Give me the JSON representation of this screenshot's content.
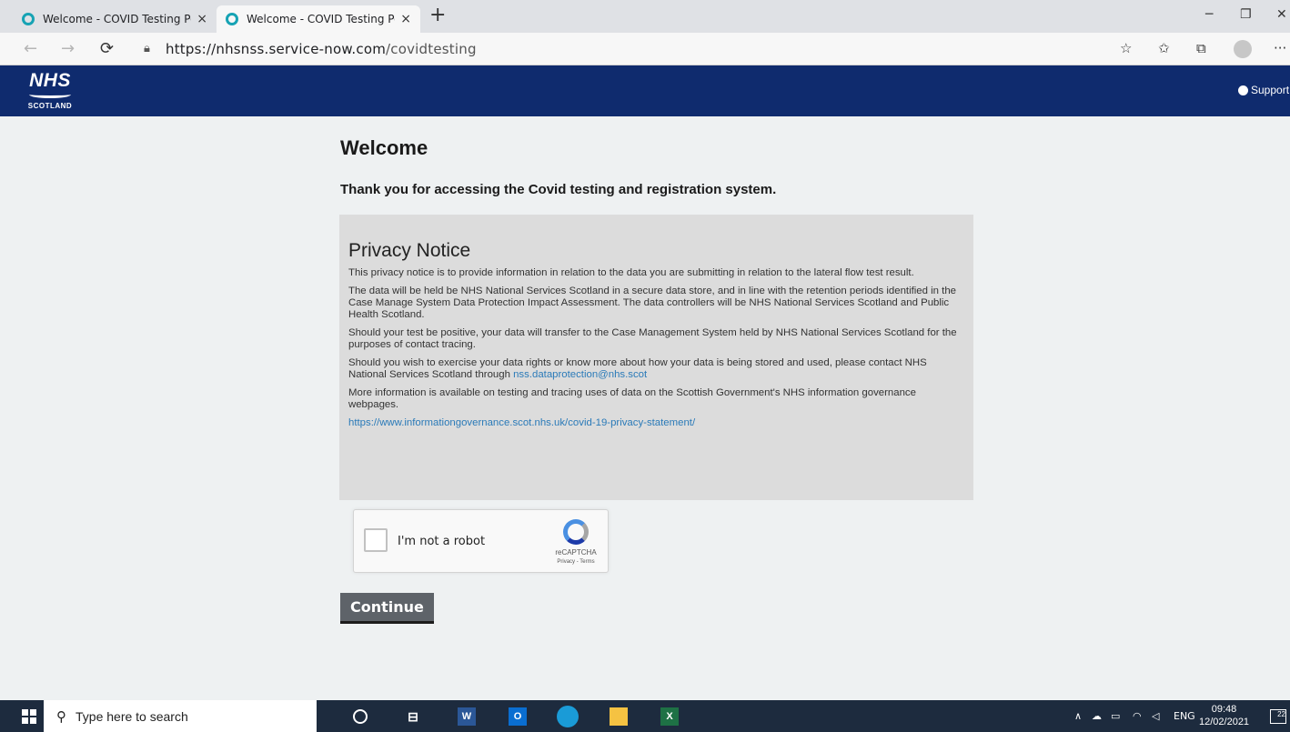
{
  "browser": {
    "tabs": [
      {
        "title": "Welcome - COVID Testing Portal",
        "close": "×"
      },
      {
        "title": "Welcome - COVID Testing Portal",
        "close": "×"
      }
    ],
    "new_tab": "+",
    "window_controls": {
      "minimize": "─",
      "maximize": "❐",
      "close": "✕"
    },
    "nav": {
      "back": "←",
      "forward": "→",
      "refresh": "⟳"
    },
    "url_host": "https://nhsnss.service-now.com",
    "url_path": "/covidtesting",
    "toolbar_icons": [
      "star-add-icon",
      "favorites-icon",
      "collections-icon",
      "profile-icon",
      "more-icon"
    ],
    "more": "···"
  },
  "header": {
    "logo_text": "NHS",
    "logo_sub": "SCOTLAND",
    "support_label": "Support"
  },
  "main": {
    "title": "Welcome",
    "subtitle": "Thank you for accessing the Covid testing and registration system.",
    "privacy": {
      "heading": "Privacy Notice",
      "p1": "This privacy notice is to provide information in relation to the data you are submitting in relation to the lateral flow test result.",
      "p2": "The data will be held be NHS National Services Scotland in a secure data store, and in line with the retention periods identified in the Case Manage System Data Protection Impact Assessment. The data controllers will be NHS National Services Scotland and Public Health Scotland.",
      "p3": "Should your test be positive, your data will transfer to the Case Management System held by NHS National Services Scotland for the purposes of contact tracing.",
      "p4": "Should you wish to exercise your data rights or know more about how your data is being stored and used, please contact NHS National Services Scotland through ",
      "p4_link": "nss.dataprotection@nhs.scot",
      "p5": "More information is available on testing and tracing uses of data on the Scottish Government's NHS information governance webpages.",
      "p6_link": "https://www.informationgovernance.scot.nhs.uk/covid-19-privacy-statement/"
    },
    "captcha": {
      "label": "I'm not a robot",
      "brand": "reCAPTCHA",
      "links": "Privacy - Terms"
    },
    "continue_label": "Continue"
  },
  "taskbar": {
    "search_placeholder": "Type here to search",
    "apps": [
      "cortana-icon",
      "task-view-icon",
      "word-icon",
      "outlook-icon",
      "edge-icon",
      "file-explorer-icon",
      "excel-icon"
    ],
    "tray_lang": "ENG",
    "time": "09:48",
    "date": "12/02/2021",
    "notifications": "22"
  }
}
